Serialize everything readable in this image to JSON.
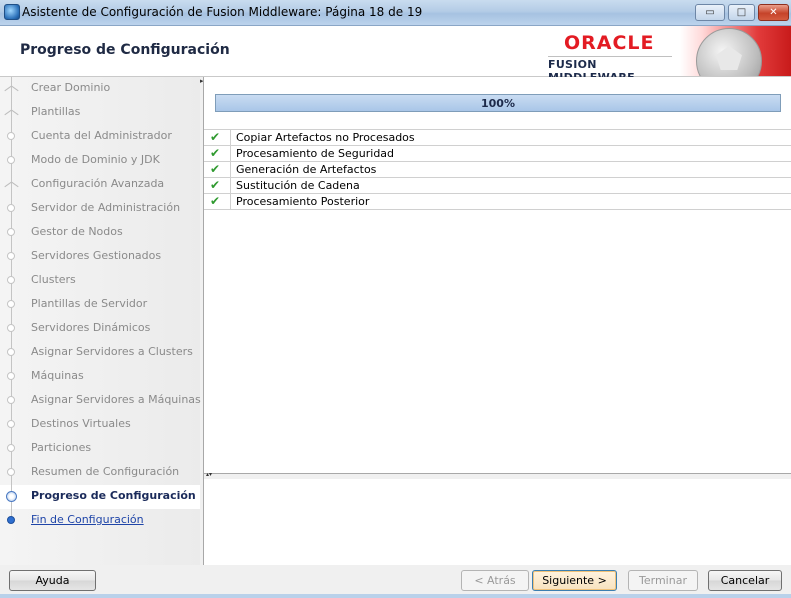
{
  "window": {
    "title": "Asistente de Configuración de Fusion Middleware: Página 18 de 19",
    "controls": {
      "minimize": "▭",
      "maximize": "□",
      "close": "✕"
    }
  },
  "header": {
    "page_title": "Progreso de Configuración",
    "logo_brand": "ORACLE",
    "logo_product": "FUSION MIDDLEWARE"
  },
  "sidebar": {
    "steps": [
      {
        "label": "Crear Dominio",
        "state": "done",
        "marker": "fork"
      },
      {
        "label": "Plantillas",
        "state": "done",
        "marker": "fork"
      },
      {
        "label": "Cuenta del Administrador",
        "state": "done",
        "marker": "node"
      },
      {
        "label": "Modo de Dominio y JDK",
        "state": "done",
        "marker": "node"
      },
      {
        "label": "Configuración Avanzada",
        "state": "done",
        "marker": "fork"
      },
      {
        "label": "Servidor de Administración",
        "state": "done",
        "marker": "node"
      },
      {
        "label": "Gestor de Nodos",
        "state": "done",
        "marker": "node"
      },
      {
        "label": "Servidores Gestionados",
        "state": "done",
        "marker": "node"
      },
      {
        "label": "Clusters",
        "state": "done",
        "marker": "node"
      },
      {
        "label": "Plantillas de Servidor",
        "state": "done",
        "marker": "node"
      },
      {
        "label": "Servidores Dinámicos",
        "state": "done",
        "marker": "node"
      },
      {
        "label": "Asignar Servidores a Clusters",
        "state": "done",
        "marker": "node"
      },
      {
        "label": "Máquinas",
        "state": "done",
        "marker": "node"
      },
      {
        "label": "Asignar Servidores a Máquinas",
        "state": "done",
        "marker": "node"
      },
      {
        "label": "Destinos Virtuales",
        "state": "done",
        "marker": "node"
      },
      {
        "label": "Particiones",
        "state": "done",
        "marker": "node"
      },
      {
        "label": "Resumen de Configuración",
        "state": "done",
        "marker": "node"
      },
      {
        "label": "Progreso de Configuración",
        "state": "active",
        "marker": "node"
      },
      {
        "label": "Fin de Configuración",
        "state": "link",
        "marker": "node"
      }
    ]
  },
  "main": {
    "progress_fraction": 1.0,
    "progress_text": "100%",
    "tasks": [
      {
        "label": "Copiar Artefactos no Procesados",
        "status_icon": "check-icon"
      },
      {
        "label": "Procesamiento de Seguridad",
        "status_icon": "check-icon"
      },
      {
        "label": "Generación de Artefactos",
        "status_icon": "check-icon"
      },
      {
        "label": "Sustitución de Cadena",
        "status_icon": "check-icon"
      },
      {
        "label": "Procesamiento Posterior",
        "status_icon": "check-icon"
      }
    ],
    "check_glyph": "✔"
  },
  "footer": {
    "help": "Ayuda",
    "back": "< Atrás",
    "next": "Siguiente >",
    "finish": "Terminar",
    "cancel": "Cancelar"
  },
  "colors": {
    "oracle_red": "#e31b23",
    "check_green": "#2f9a2f",
    "link_blue": "#1f45a8"
  }
}
